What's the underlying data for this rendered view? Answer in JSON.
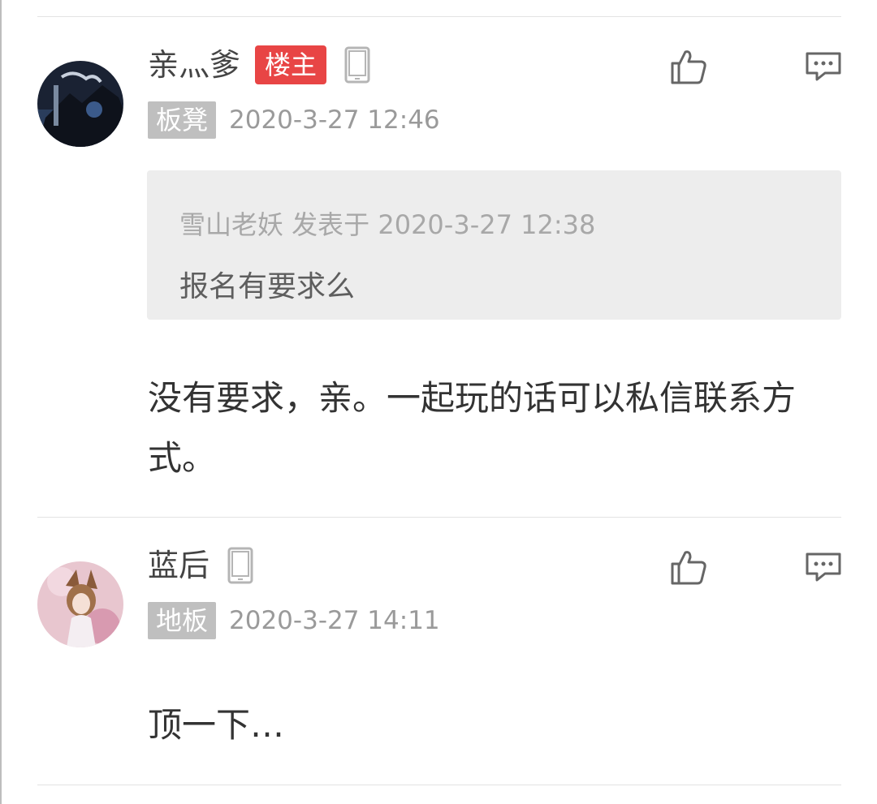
{
  "posts": [
    {
      "author": "亲灬爹",
      "op_badge": "楼主",
      "device_icon": "phone-icon",
      "floor": "板凳",
      "time": "2020-3-27 12:46",
      "quote": {
        "header": "雪山老妖 发表于 2020-3-27 12:38",
        "text": "报名有要求么"
      },
      "content": "没有要求，亲。一起玩的话可以私信联系方式。",
      "actions": [
        "like-icon",
        "reply-icon"
      ]
    },
    {
      "author": "蓝后",
      "device_icon": "phone-icon",
      "floor": "地板",
      "time": "2020-3-27 14:11",
      "content": "顶一下…",
      "actions": [
        "like-icon",
        "reply-icon"
      ]
    }
  ],
  "colors": {
    "op_badge": "#e84545",
    "floor_badge": "#bfbfbf",
    "quote_bg": "#ededed",
    "divider": "#e3e3e3"
  }
}
